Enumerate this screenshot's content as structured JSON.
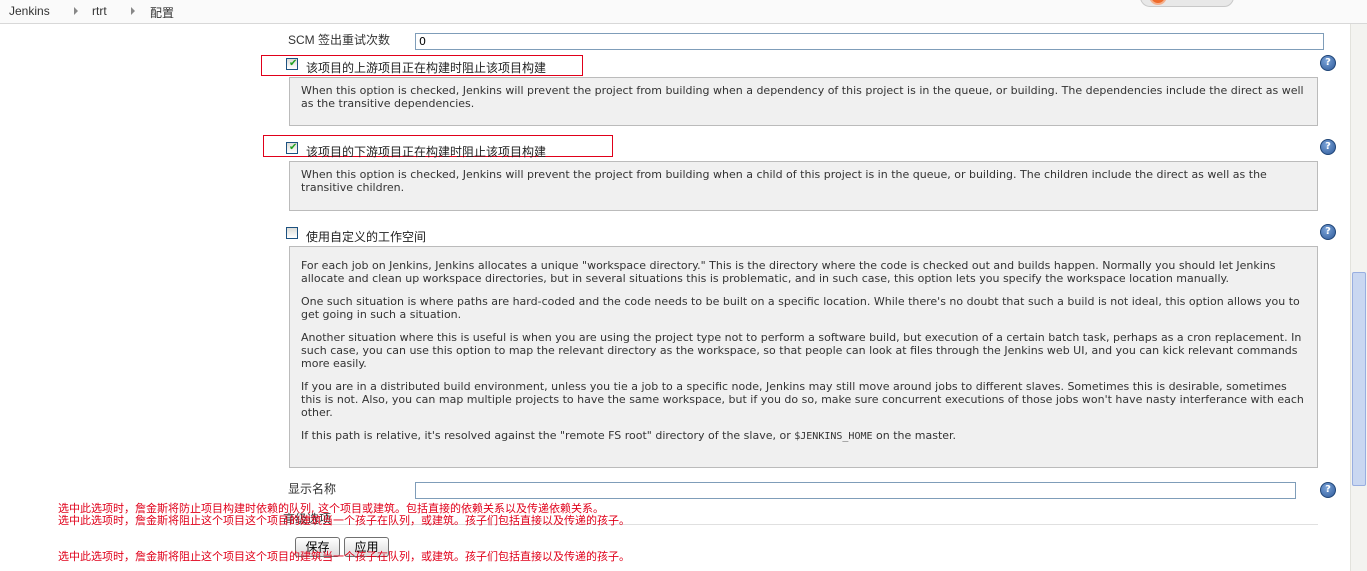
{
  "breadcrumb": {
    "items": [
      "Jenkins",
      "rtrt",
      "配置"
    ]
  },
  "scm": {
    "label": "SCM 签出重试次数",
    "value": "0"
  },
  "block_upstream": {
    "checked": true,
    "label": "该项目的上游项目正在构建时阻止该项目构建",
    "help": "When this option is checked, Jenkins will prevent the project from building when a dependency of this project is in the queue, or building. The dependencies include the direct as well as the transitive dependencies."
  },
  "block_downstream": {
    "checked": true,
    "label": "该项目的下游项目正在构建时阻止该项目构建",
    "help": "When this option is checked, Jenkins will prevent the project from building when a child of this project is in the queue, or building. The children include the direct as well as the transitive children."
  },
  "custom_workspace": {
    "checked": false,
    "label": "使用自定义的工作空间",
    "help": [
      "For each job on Jenkins, Jenkins allocates a unique \"workspace directory.\" This is the directory where the code is checked out and builds happen. Normally you should let Jenkins allocate and clean up workspace directories, but in several situations this is problematic, and in such case, this option lets you specify the workspace location manually.",
      "One such situation is where paths are hard-coded and the code needs to be built on a specific location. While there's no doubt that such a build is not ideal, this option allows you to get going in such a situation.",
      "Another situation where this is useful is when you are using the project type not to perform a software build, but execution of a certain batch task, perhaps as a cron replacement. In such case, you can use this option to map the relevant directory as the workspace, so that people can look at files through the Jenkins web UI, and you can kick relevant commands more easily.",
      "If you are in a distributed build environment, unless you tie a job to a specific node, Jenkins may still move around jobs to different slaves. Sometimes this is desirable, sometimes this is not. Also, you can map multiple projects to have the same workspace, but if you do so, make sure concurrent executions of those jobs won't have nasty interferance with each other."
    ],
    "help_last_prefix": "If this path is relative, it's resolved against the \"remote FS root\" directory of the slave, or ",
    "help_last_code": "$JENKINS_HOME",
    "help_last_suffix": " on the master."
  },
  "display_name": {
    "label": "显示名称",
    "value": ""
  },
  "obscured_label": "高级选项",
  "overlay_translations": [
    "选中此选项时，詹金斯将防止项目构建时依赖的队列, 这个项目或建筑。包括直接的依赖关系以及传递依赖关系。",
    "选中此选项时，詹金斯将阻止这个项目这个项目的建筑当一个孩子在队列，或建筑。孩子们包括直接以及传递的孩子。",
    "选中此选项时，詹金斯将阻止这个项目这个项目的建筑当一个孩子在队列，或建筑。孩子们包括直接以及传递的孩子。"
  ],
  "buttons": {
    "save": "保存",
    "apply": "应用"
  },
  "icons": {
    "help": "help-icon",
    "separator": "chevron-right-icon"
  },
  "colors": {
    "highlight_red": "#e0001a",
    "help_bg": "#f0f0f0",
    "help_icon": "#2e5a9a"
  }
}
